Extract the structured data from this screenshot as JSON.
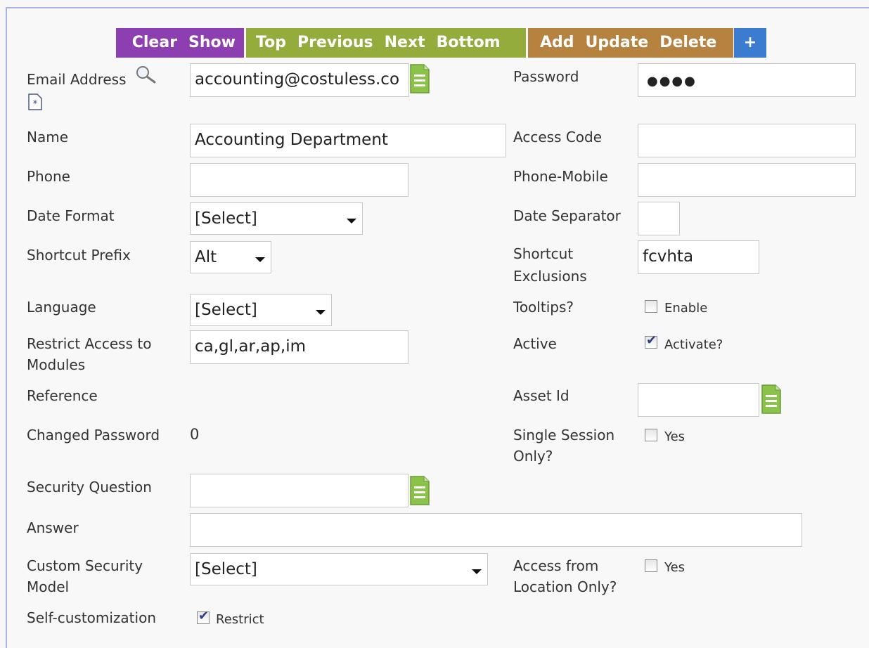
{
  "toolbar": {
    "clear": "Clear",
    "show": "Show",
    "top": "Top",
    "previous": "Previous",
    "next": "Next",
    "bottom": "Bottom",
    "add": "Add",
    "update": "Update",
    "delete": "Delete",
    "plus": "+"
  },
  "fields": {
    "email_label": "Email Address",
    "email_value": "accounting@costuless.co",
    "password_label": "Password",
    "password_value": "●●●●",
    "name_label": "Name",
    "name_value": "Accounting Department",
    "access_code_label": "Access Code",
    "access_code_value": "",
    "phone_label": "Phone",
    "phone_value": "",
    "phone_mobile_label": "Phone-Mobile",
    "phone_mobile_value": "",
    "date_format_label": "Date Format",
    "date_format_value": "[Select]",
    "date_separator_label": "Date Separator",
    "date_separator_value": "",
    "shortcut_prefix_label": "Shortcut Prefix",
    "shortcut_prefix_value": "Alt",
    "shortcut_exclusions_label_1": "Shortcut",
    "shortcut_exclusions_label_2": "Exclusions",
    "shortcut_exclusions_value": "fcvhta",
    "language_label": "Language",
    "language_value": "[Select]",
    "tooltips_label": "Tooltips?",
    "tooltips_option": "Enable",
    "restrict_label_1": "Restrict Access to",
    "restrict_label_2": "Modules",
    "restrict_value": "ca,gl,ar,ap,im",
    "active_label": "Active",
    "active_option": "Activate?",
    "reference_label": "Reference",
    "asset_id_label": "Asset Id",
    "asset_id_value": "",
    "changed_password_label": "Changed Password",
    "changed_password_value": "0",
    "single_session_label_1": "Single Session",
    "single_session_label_2": "Only?",
    "single_session_option": "Yes",
    "security_question_label": "Security Question",
    "security_question_value": "",
    "answer_label": "Answer",
    "answer_value": "",
    "custom_security_label_1": "Custom Security",
    "custom_security_label_2": "Model",
    "custom_security_value": "[Select]",
    "access_location_label_1": "Access from",
    "access_location_label_2": "Location Only?",
    "access_location_option": "Yes",
    "self_customization_label": "Self-customization",
    "self_customization_option": "Restrict"
  },
  "checkbox_states": {
    "tooltips": false,
    "active": true,
    "single_session": false,
    "access_location": false,
    "self_customization": true
  },
  "icons": {
    "search": "search-icon",
    "new_record": "new-document-icon",
    "lookup": "lookup-document-icon"
  }
}
